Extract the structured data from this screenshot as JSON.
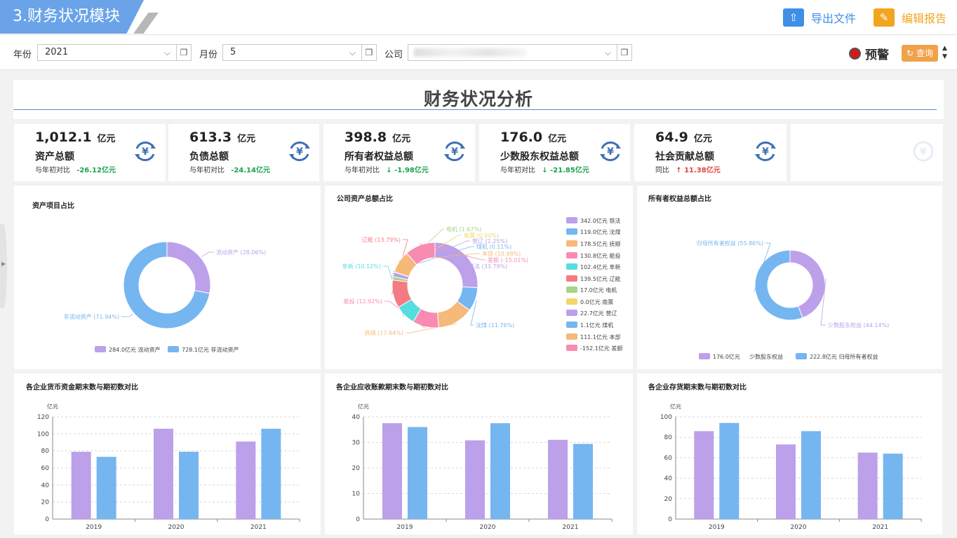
{
  "header": {
    "module_title": "3.财务状况模块",
    "export_label": "导出文件",
    "edit_label": "编辑报告",
    "export_icon": "upload-folder-icon",
    "edit_icon": "edit-pencil-icon"
  },
  "filters": {
    "year_label": "年份",
    "year_value": "2021",
    "month_label": "月份",
    "month_value": "5",
    "company_label": "公司",
    "company_value": "",
    "warning_label": "预警",
    "query_label": "查询"
  },
  "page_title": "财务状况分析",
  "kpis": [
    {
      "value": "1,012.1",
      "unit": "亿元",
      "name": "资产总额",
      "compare_label": "与年初对比",
      "arrow": "",
      "change": "-26.12亿元",
      "change_color": "#1aa34a"
    },
    {
      "value": "613.3",
      "unit": "亿元",
      "name": "负债总额",
      "compare_label": "与年初对比",
      "arrow": "",
      "change": "-24.14亿元",
      "change_color": "#1aa34a"
    },
    {
      "value": "398.8",
      "unit": "亿元",
      "name": "所有者权益总额",
      "compare_label": "与年初对比",
      "arrow": "↓",
      "change": "-1.98亿元",
      "change_color": "#1aa34a"
    },
    {
      "value": "176.0",
      "unit": "亿元",
      "name": "少数股东权益总额",
      "compare_label": "与年初对比",
      "arrow": "↓",
      "change": "-21.85亿元",
      "change_color": "#1aa34a"
    },
    {
      "value": "64.9",
      "unit": "亿元",
      "name": "社会贡献总额",
      "compare_label": "同比",
      "arrow": "↑",
      "change": "11.38亿元",
      "change_color": "#e0443e"
    }
  ],
  "colors": {
    "purple": "#bca0ea",
    "blue": "#75b6f0",
    "kpi_icon": "#3f6fb5"
  },
  "chart_data": [
    {
      "type": "pie",
      "title": "资产项目占比",
      "slices": [
        {
          "name": "流动资产",
          "value": 284.0,
          "label": "流动资产 (28.06%)",
          "legend": "284.0亿元  流动资产",
          "color": "#bca0ea"
        },
        {
          "name": "非流动资产",
          "value": 728.1,
          "label": "非流动资产 (71.94%)",
          "legend": "728.1亿元  非流动资产",
          "color": "#75b6f0"
        }
      ]
    },
    {
      "type": "pie",
      "title": "公司资产总额占比",
      "slices": [
        {
          "name": "铁法",
          "value": 342.0,
          "label": "铁法 (33.79%)",
          "legend": "342.0亿元  铁法",
          "color": "#bca0ea"
        },
        {
          "name": "沈煤",
          "value": 119.0,
          "label": "沈煤 (11.76%)",
          "legend": "119.0亿元  沈煤",
          "color": "#75b6f0"
        },
        {
          "name": "抚顺",
          "value": 178.5,
          "label": "抚顺 (17.64%)",
          "legend": "178.5亿元  抚顺",
          "color": "#f5b97a"
        },
        {
          "name": "能投",
          "value": 130.8,
          "label": "能投 (12.92%)",
          "legend": "130.8亿元  能投",
          "color": "#f98bb3"
        },
        {
          "name": "阜新",
          "value": 102.4,
          "label": "阜新 (10.12%)",
          "legend": "102.4亿元  阜新",
          "color": "#56dde0"
        },
        {
          "name": "辽能",
          "value": 139.5,
          "label": "辽能 (13.79%)",
          "legend": "139.5亿元  辽能",
          "color": "#f47a83"
        },
        {
          "name": "电机",
          "value": 17.0,
          "label": "电机 (1.67%)",
          "legend": "17.0亿元  电机",
          "color": "#a8d486"
        },
        {
          "name": "南票",
          "value": 0.0,
          "label": "南票 (0.00%)",
          "legend": "0.0亿元  南票",
          "color": "#f3d66b"
        },
        {
          "name": "营辽",
          "value": 22.7,
          "label": "营辽 (2.25%)",
          "legend": "22.7亿元  营辽",
          "color": "#bca0ea"
        },
        {
          "name": "煤机",
          "value": 1.1,
          "label": "煤机 (0.11%)",
          "legend": "1.1亿元  煤机",
          "color": "#75b6f0"
        },
        {
          "name": "本部",
          "value": 111.1,
          "label": "本部 (10.98%)",
          "legend": "111.1亿元  本部",
          "color": "#f5b97a"
        },
        {
          "name": "差额",
          "value": -152.1,
          "label": "差额 (-15.01%)",
          "legend": "-152.1亿元  差额",
          "color": "#f98bb3"
        }
      ]
    },
    {
      "type": "pie",
      "title": "所有者权益总额占比",
      "slices": [
        {
          "name": "少数股东权益",
          "value": 176.0,
          "label": "少数股东权益 (44.14%)",
          "legend": "176.0亿元",
          "legend_name": "少数股东权益",
          "color": "#bca0ea"
        },
        {
          "name": "归母所有者权益",
          "value": 222.8,
          "label": "归母所有者权益 (55.86%)",
          "legend": "222.8亿元  归母所有者权益",
          "color": "#75b6f0"
        }
      ]
    },
    {
      "type": "bar",
      "title": "各企业货币资金期末数与期初数对比",
      "ylabel": "亿元",
      "categories": [
        "2019",
        "2020",
        "2021"
      ],
      "ylim": [
        0,
        120
      ],
      "yticks": [
        0,
        20,
        40,
        60,
        80,
        100,
        120
      ],
      "series": [
        {
          "values": [
            79,
            106,
            91
          ],
          "color": "#bca0ea"
        },
        {
          "values": [
            73,
            79,
            106
          ],
          "color": "#75b6f0"
        }
      ]
    },
    {
      "type": "bar",
      "title": "各企业应收账款期末数与期初数对比",
      "ylabel": "亿元",
      "categories": [
        "2019",
        "2020",
        "2021"
      ],
      "ylim": [
        0,
        40
      ],
      "yticks": [
        0,
        10,
        20,
        30,
        40
      ],
      "series": [
        {
          "values": [
            37.5,
            30.8,
            31.0
          ],
          "color": "#bca0ea"
        },
        {
          "values": [
            36.0,
            37.5,
            29.4
          ],
          "color": "#75b6f0"
        }
      ]
    },
    {
      "type": "bar",
      "title": "各企业存货期末数与期初数对比",
      "ylabel": "亿元",
      "categories": [
        "2019",
        "2020",
        "2021"
      ],
      "ylim": [
        0,
        100
      ],
      "yticks": [
        0,
        20,
        40,
        60,
        80,
        100
      ],
      "series": [
        {
          "values": [
            86,
            73,
            65
          ],
          "color": "#bca0ea"
        },
        {
          "values": [
            94,
            86,
            64
          ],
          "color": "#75b6f0"
        }
      ]
    }
  ]
}
